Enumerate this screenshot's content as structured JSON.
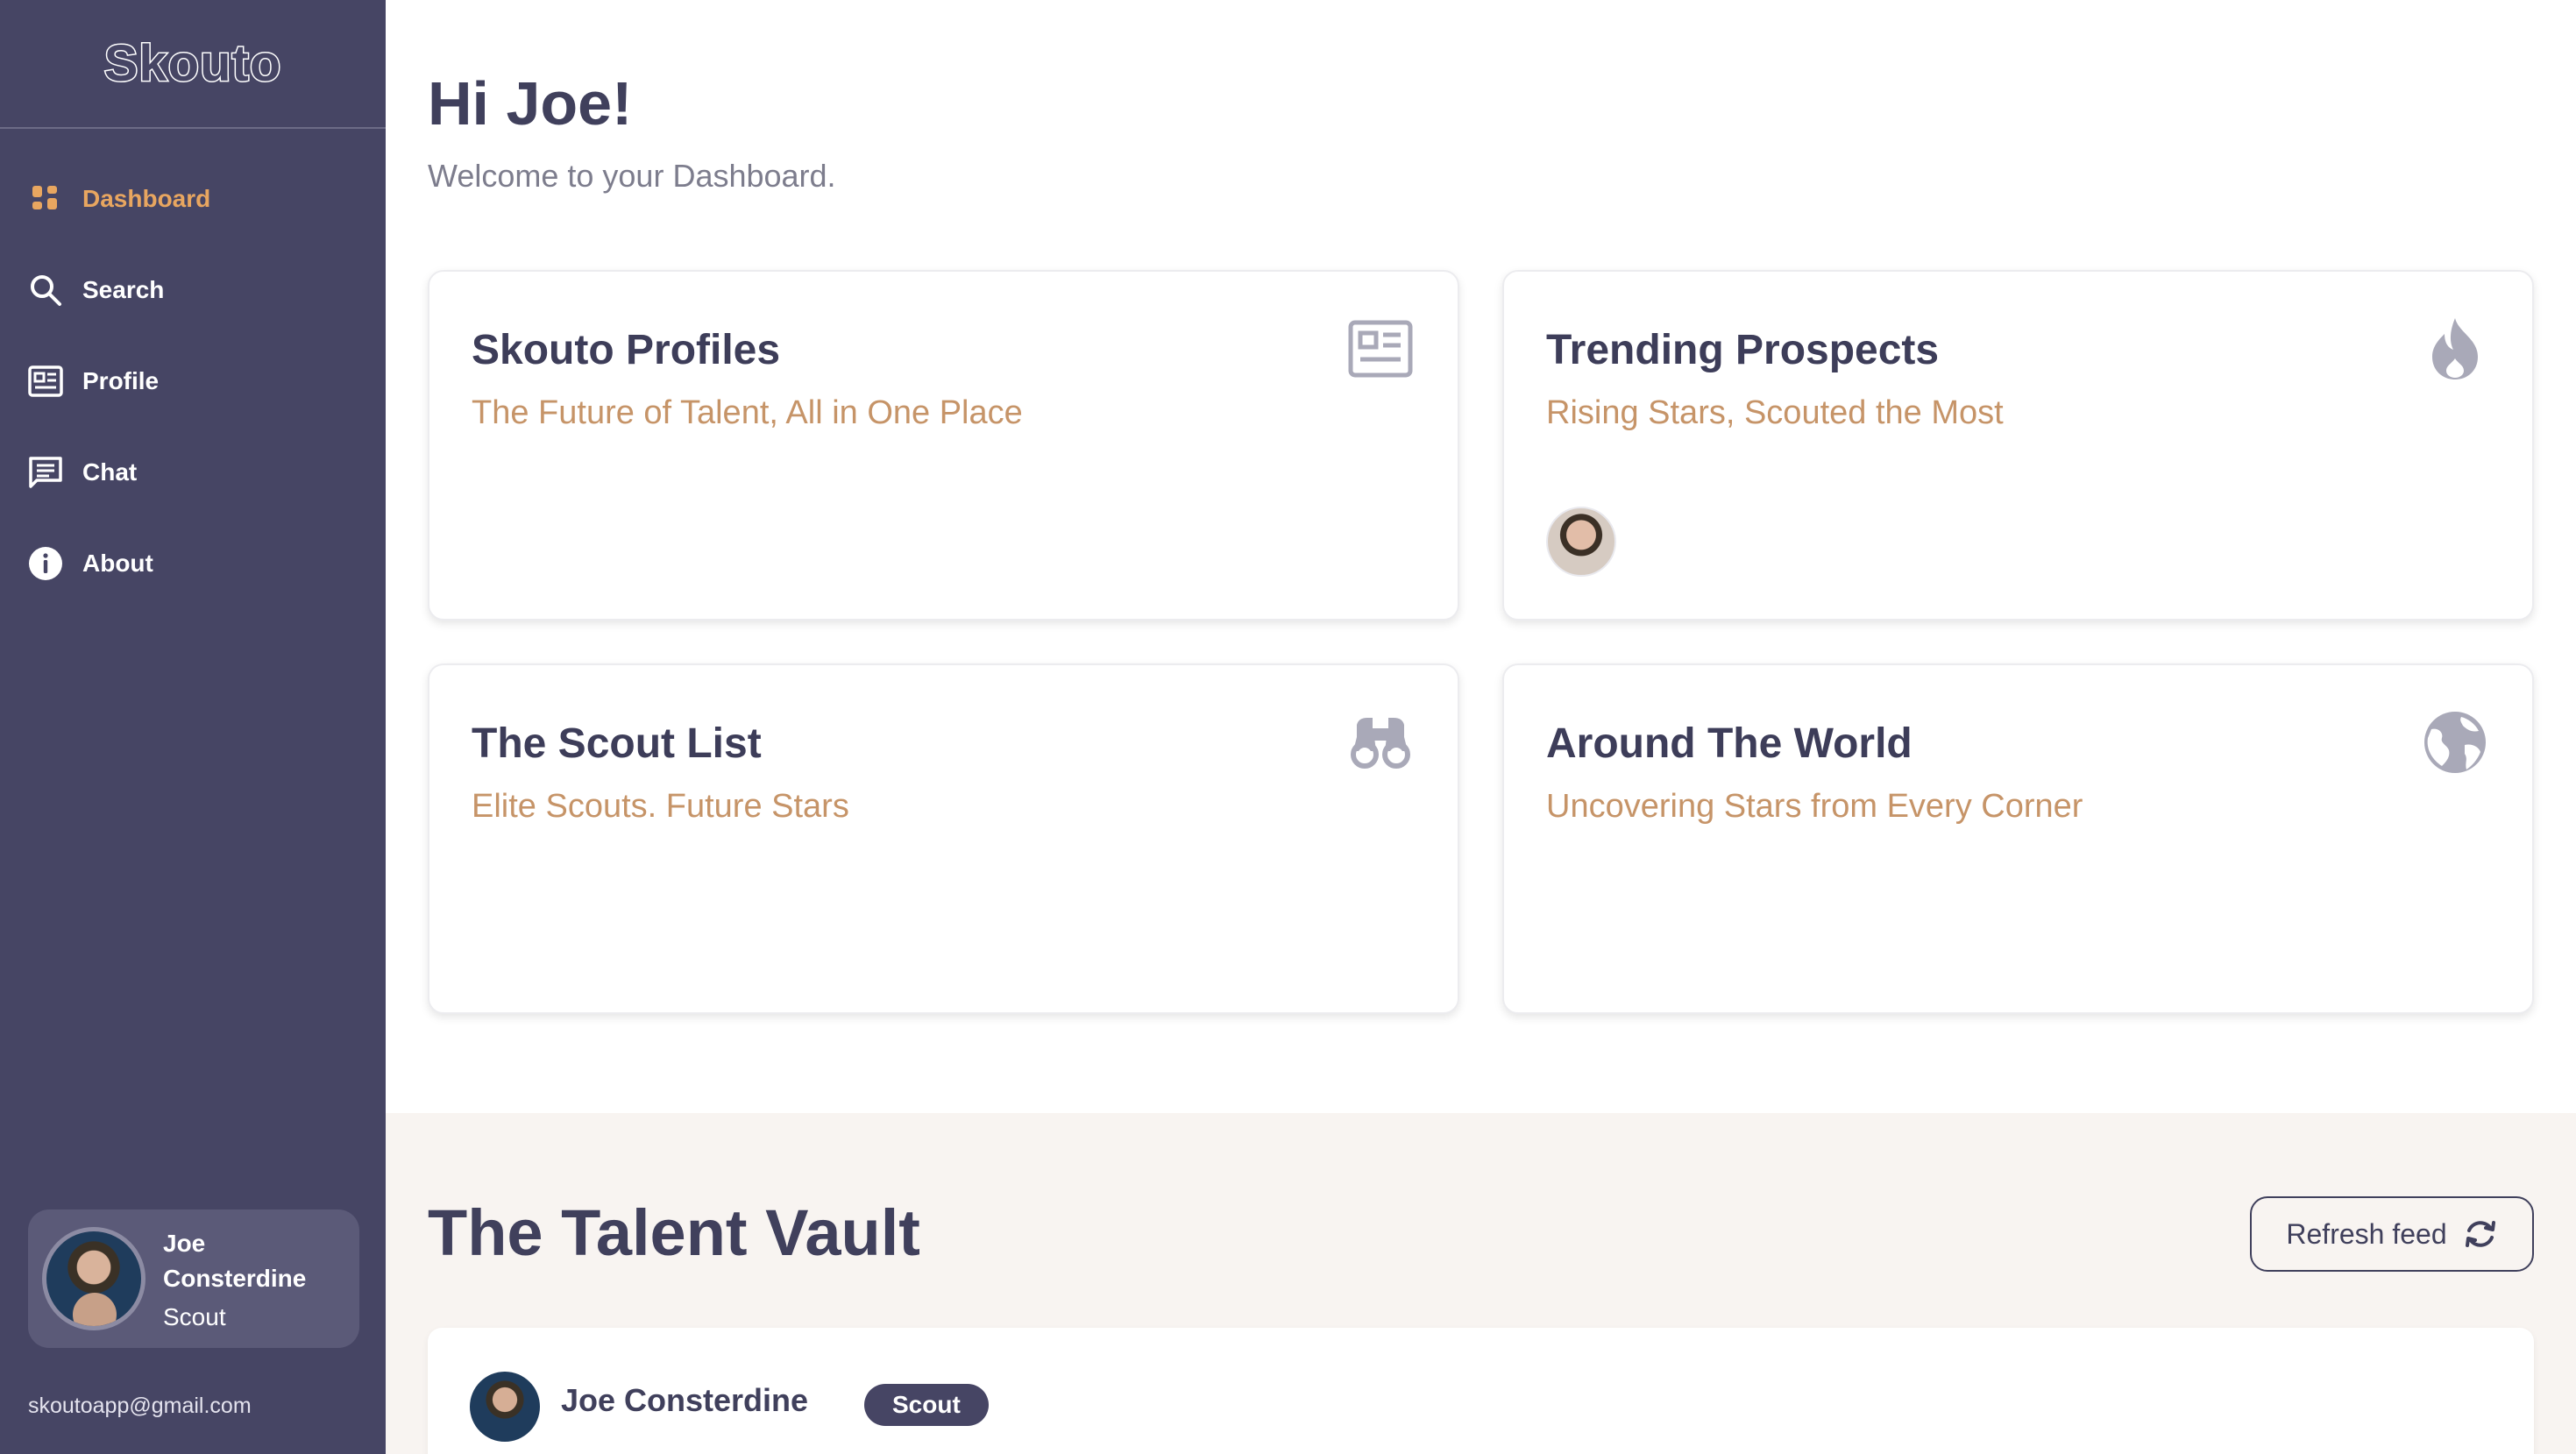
{
  "app": {
    "logo_text": "Skouto",
    "support_email": "skoutoapp@gmail.com"
  },
  "sidebar": {
    "items": [
      {
        "label": "Dashboard",
        "icon": "dashboard-grid-icon",
        "active": true
      },
      {
        "label": "Search",
        "icon": "search-icon",
        "active": false
      },
      {
        "label": "Profile",
        "icon": "profile-card-icon",
        "active": false
      },
      {
        "label": "Chat",
        "icon": "chat-icon",
        "active": false
      },
      {
        "label": "About",
        "icon": "info-icon",
        "active": false
      }
    ]
  },
  "user": {
    "name": "Joe Consterdine",
    "role": "Scout"
  },
  "header": {
    "greeting": "Hi Joe!",
    "subtitle": "Welcome to your Dashboard."
  },
  "cards": [
    {
      "title": "Skouto Profiles",
      "subtitle": "The Future of Talent, All in One Place",
      "icon": "id-card-icon"
    },
    {
      "title": "Trending Prospects",
      "subtitle": "Rising Stars, Scouted the Most",
      "icon": "flame-icon"
    },
    {
      "title": "The Scout List",
      "subtitle": "Elite Scouts. Future Stars",
      "icon": "binoculars-icon"
    },
    {
      "title": "Around The World",
      "subtitle": "Uncovering Stars from Every Corner",
      "icon": "globe-icon"
    }
  ],
  "vault": {
    "title": "The Talent Vault",
    "refresh_label": "Refresh feed",
    "posts": [
      {
        "author": "Joe Consterdine",
        "role": "Scout"
      }
    ]
  },
  "colors": {
    "sidebar_bg": "#464564",
    "accent": "#e8a660",
    "subtitle": "#c69468",
    "text_dark": "#40405c",
    "vault_bg": "#f8f4f1"
  }
}
